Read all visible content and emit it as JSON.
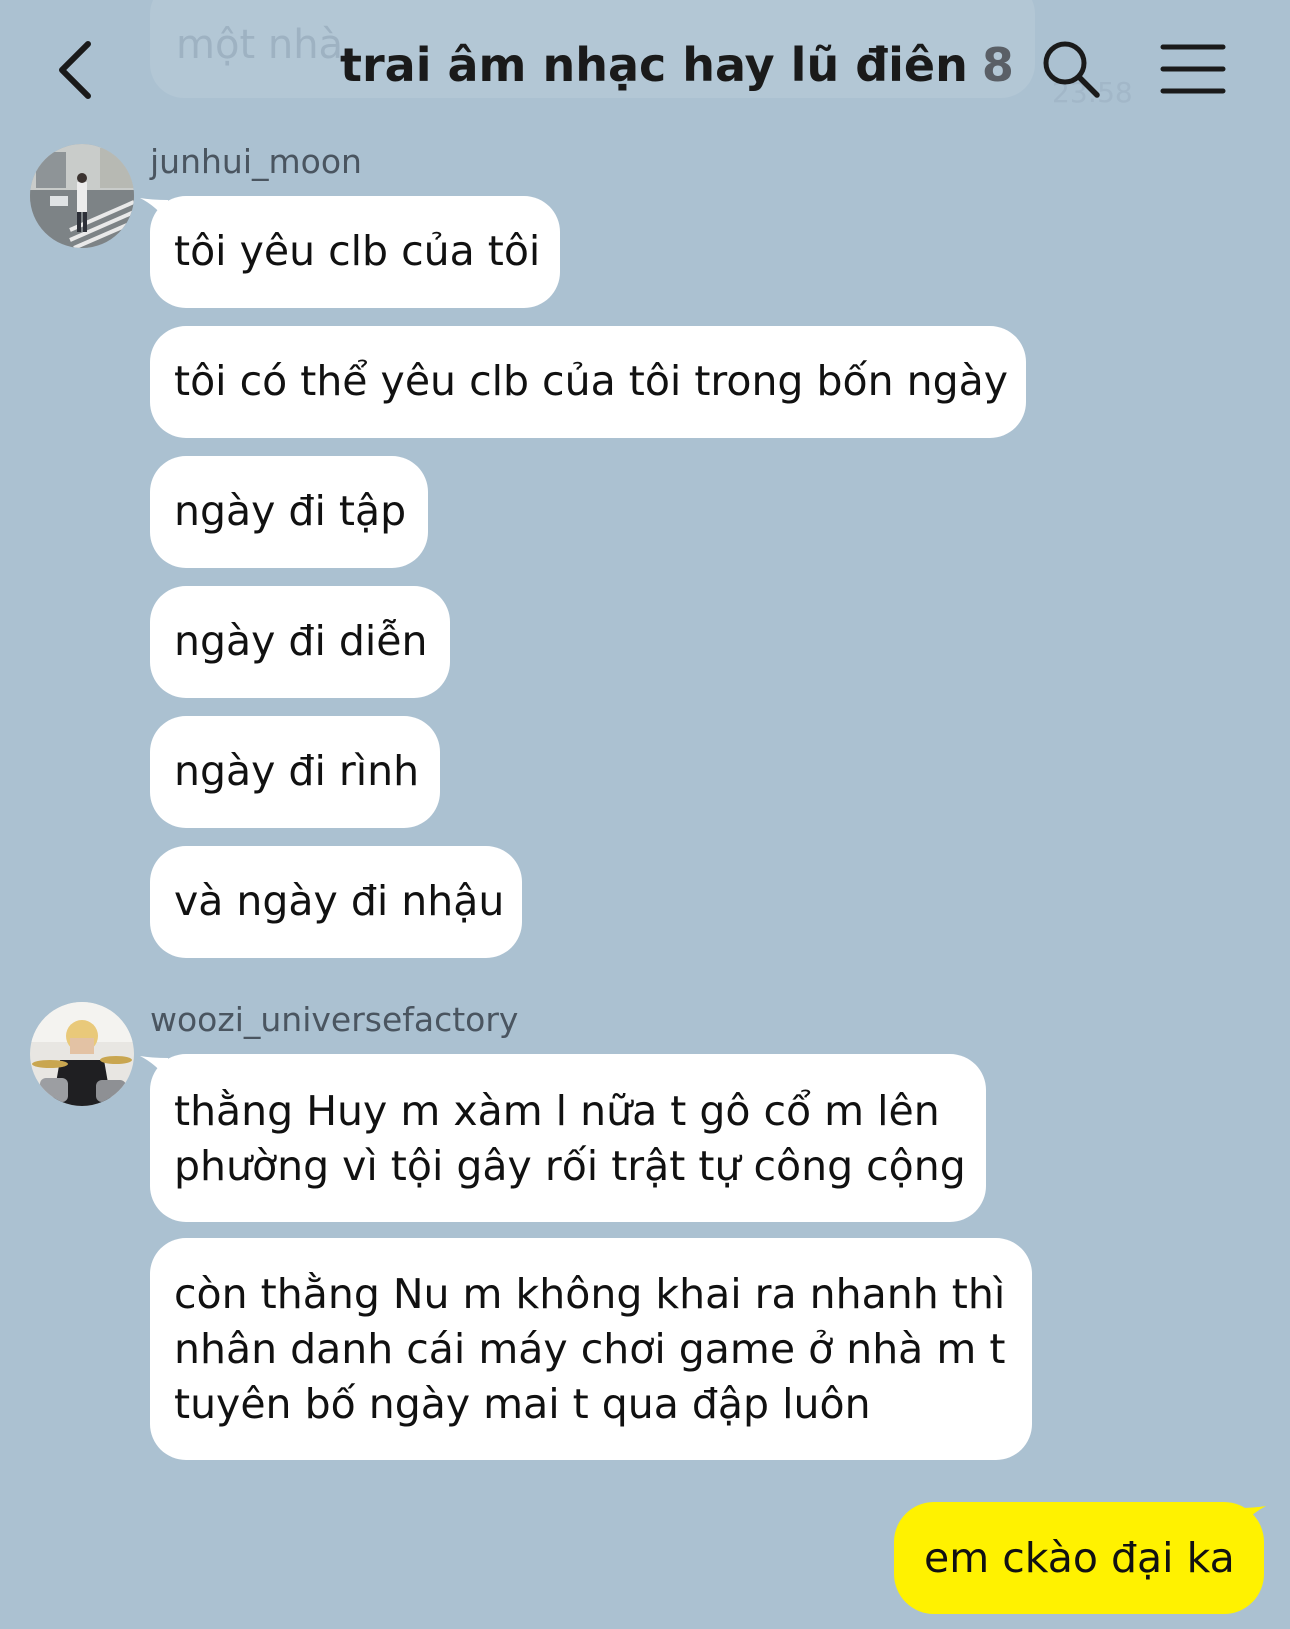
{
  "background_ghost": {
    "text": "một nhà",
    "time": "23:58"
  },
  "header": {
    "title": "trai âm nhạc hay lũ điên",
    "member_count": "8"
  },
  "messages": [
    {
      "sender": "junhui_moon",
      "bubbles": [
        {
          "lines": [
            "tôi yêu clb của tôi"
          ]
        },
        {
          "lines": [
            "tôi có thể yêu clb của tôi trong bốn ngày"
          ]
        },
        {
          "lines": [
            "ngày đi tập"
          ]
        },
        {
          "lines": [
            "ngày đi diễn"
          ]
        },
        {
          "lines": [
            "ngày đi rình"
          ]
        },
        {
          "lines": [
            "và ngày đi nhậu"
          ]
        }
      ]
    },
    {
      "sender": "woozi_universefactory",
      "bubbles": [
        {
          "lines": [
            "thằng Huy m xàm l nữa t gô cổ m lên",
            "phường vì tội gây rối trật tự công cộng"
          ]
        },
        {
          "lines": [
            "còn thằng Nu m không khai ra nhanh thì",
            "nhân danh cái máy chơi game ở nhà m t",
            "tuyên bố ngày mai t qua đập luôn"
          ]
        }
      ]
    }
  ],
  "my_message": {
    "text": "em ckào đại ka"
  },
  "colors": {
    "background": "#abc1d1",
    "incoming_bubble": "#ffffff",
    "outgoing_bubble": "#fff200"
  },
  "icons": [
    "back-arrow-icon",
    "search-icon",
    "hamburger-menu-icon"
  ]
}
